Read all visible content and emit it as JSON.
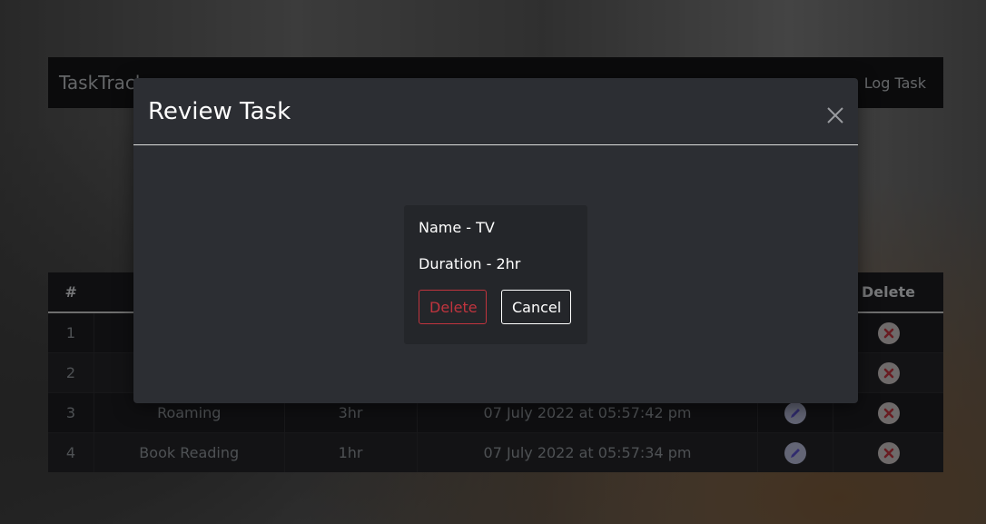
{
  "navbar": {
    "brand": "TaskTrack",
    "log_task": "Log Task"
  },
  "table": {
    "headers": {
      "num": "#",
      "delete": "Delete"
    },
    "rows": [
      {
        "num": "1",
        "name": "",
        "duration": "",
        "date": ""
      },
      {
        "num": "2",
        "name": "",
        "duration": "",
        "date": ""
      },
      {
        "num": "3",
        "name": "Roaming",
        "duration": "3hr",
        "date": "07 July 2022 at 05:57:42 pm"
      },
      {
        "num": "4",
        "name": "Book Reading",
        "duration": "1hr",
        "date": "07 July 2022 at 05:57:34 pm"
      }
    ]
  },
  "modal": {
    "title": "Review Task",
    "name_line": "Name - TV",
    "duration_line": "Duration - 2hr",
    "delete_label": "Delete",
    "cancel_label": "Cancel"
  },
  "colors": {
    "danger": "#c0343e",
    "modal_bg": "#2c2e33",
    "navbar_bg": "#141517"
  },
  "icons": [
    "close-icon",
    "edit-icon",
    "delete-icon"
  ]
}
